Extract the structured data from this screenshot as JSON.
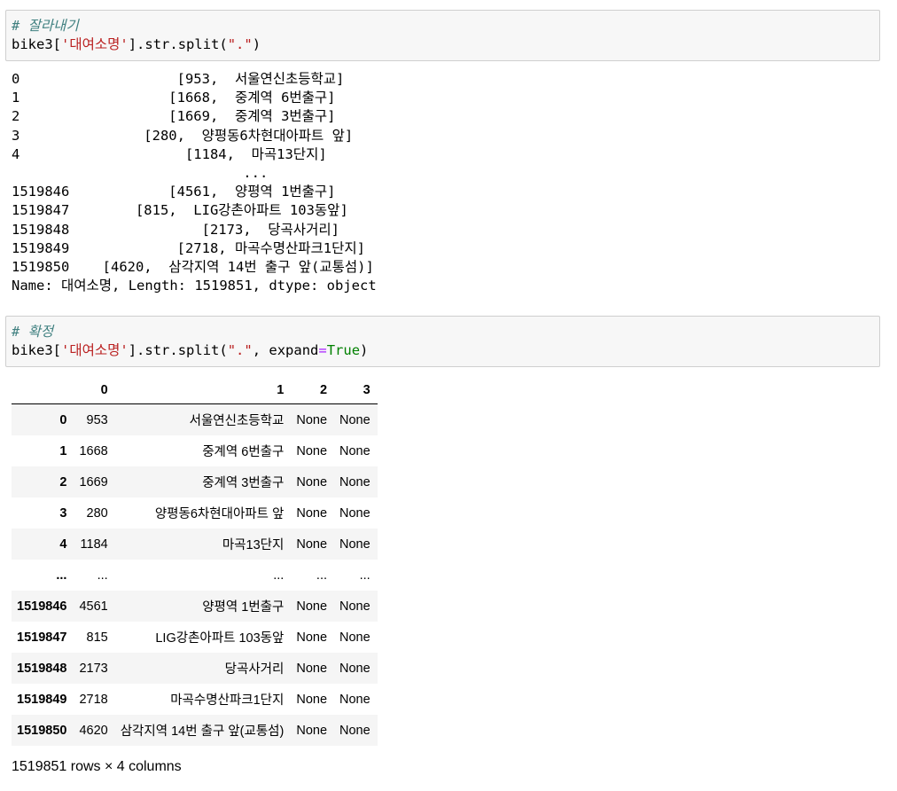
{
  "cell1": {
    "comment": "# 잘라내기",
    "code_prefix": "bike3[",
    "code_string": "'대여소명'",
    "code_mid": "].str.split(",
    "code_arg": "\".\"",
    "code_suffix": ")"
  },
  "output1": {
    "text": "0                   [953,  서울연신초등학교]\n1                  [1668,  중계역 6번출구]\n2                  [1669,  중계역 3번출구]\n3               [280,  양평동6차현대아파트 앞]\n4                    [1184,  마곡13단지]\n                            ...\n1519846            [4561,  양평역 1번출구]\n1519847        [815,  LIG강촌아파트 103동앞]\n1519848                [2173,  당곡사거리]\n1519849             [2718, 마곡수명산파크1단지]\n1519850    [4620,  삼각지역 14번 출구 앞(교통섬)]\nName: 대여소명, Length: 1519851, dtype: object"
  },
  "cell2": {
    "comment": "# 확정",
    "code_prefix": "bike3[",
    "code_string": "'대여소명'",
    "code_mid": "].str.split(",
    "code_arg": "\".\"",
    "code_sep": ", expand",
    "code_eq": "=",
    "code_true": "True",
    "code_suffix": ")"
  },
  "table": {
    "columns": [
      "",
      "0",
      "1",
      "2",
      "3"
    ],
    "rows": [
      [
        "0",
        "953",
        "서울연신초등학교",
        "None",
        "None"
      ],
      [
        "1",
        "1668",
        "중계역 6번출구",
        "None",
        "None"
      ],
      [
        "2",
        "1669",
        "중계역 3번출구",
        "None",
        "None"
      ],
      [
        "3",
        "280",
        "양평동6차현대아파트 앞",
        "None",
        "None"
      ],
      [
        "4",
        "1184",
        "마곡13단지",
        "None",
        "None"
      ],
      [
        "...",
        "...",
        "...",
        "...",
        "..."
      ],
      [
        "1519846",
        "4561",
        "양평역 1번출구",
        "None",
        "None"
      ],
      [
        "1519847",
        "815",
        "LIG강촌아파트 103동앞",
        "None",
        "None"
      ],
      [
        "1519848",
        "2173",
        "당곡사거리",
        "None",
        "None"
      ],
      [
        "1519849",
        "2718",
        "마곡수명산파크1단지",
        "None",
        "None"
      ],
      [
        "1519850",
        "4620",
        "삼각지역 14번 출구 앞(교통섬)",
        "None",
        "None"
      ]
    ]
  },
  "shape_text": "1519851 rows × 4 columns"
}
